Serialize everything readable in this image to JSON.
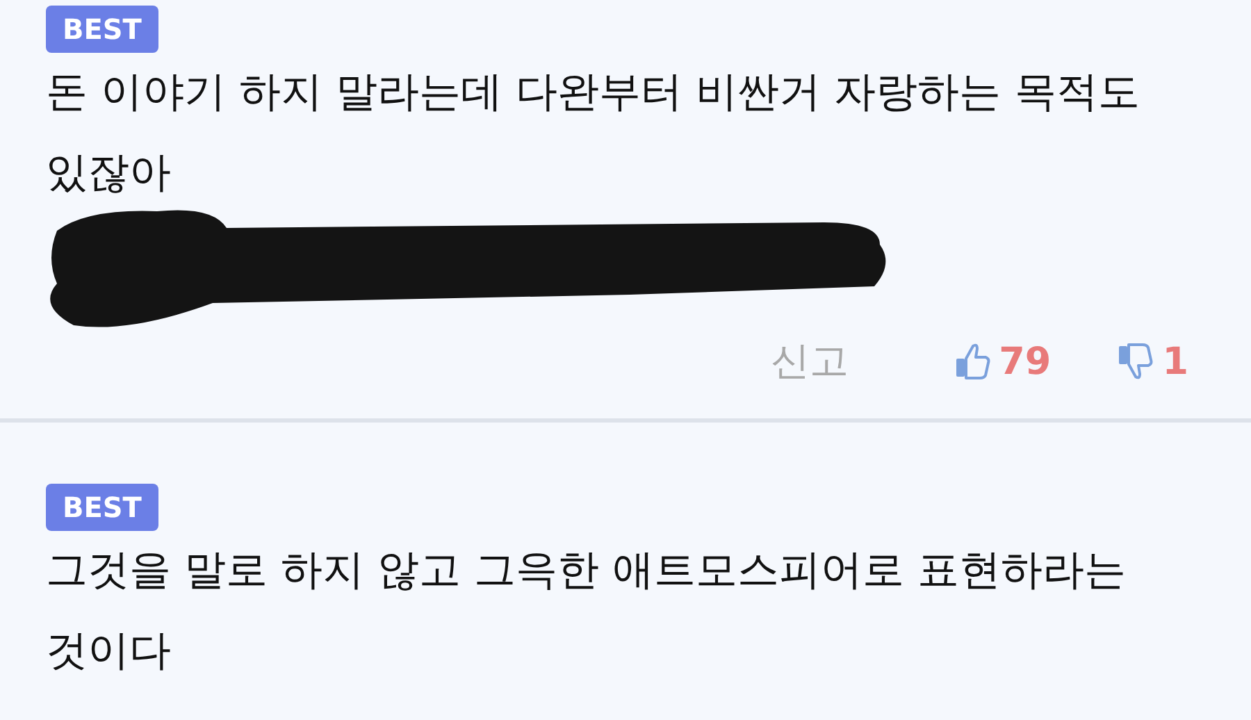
{
  "comments": [
    {
      "badge": "BEST",
      "text": "돈 이야기 하지 말라는데 다완부터 비싼거 자랑하는 목적도 있잖아",
      "redacted": true,
      "actions": {
        "report": "신고",
        "likes": "79",
        "dislikes": "1"
      }
    },
    {
      "badge": "BEST",
      "text": "그것을 말로 하지 않고 그윽한 애트모스피어로 표현하라는 것이다"
    }
  ]
}
